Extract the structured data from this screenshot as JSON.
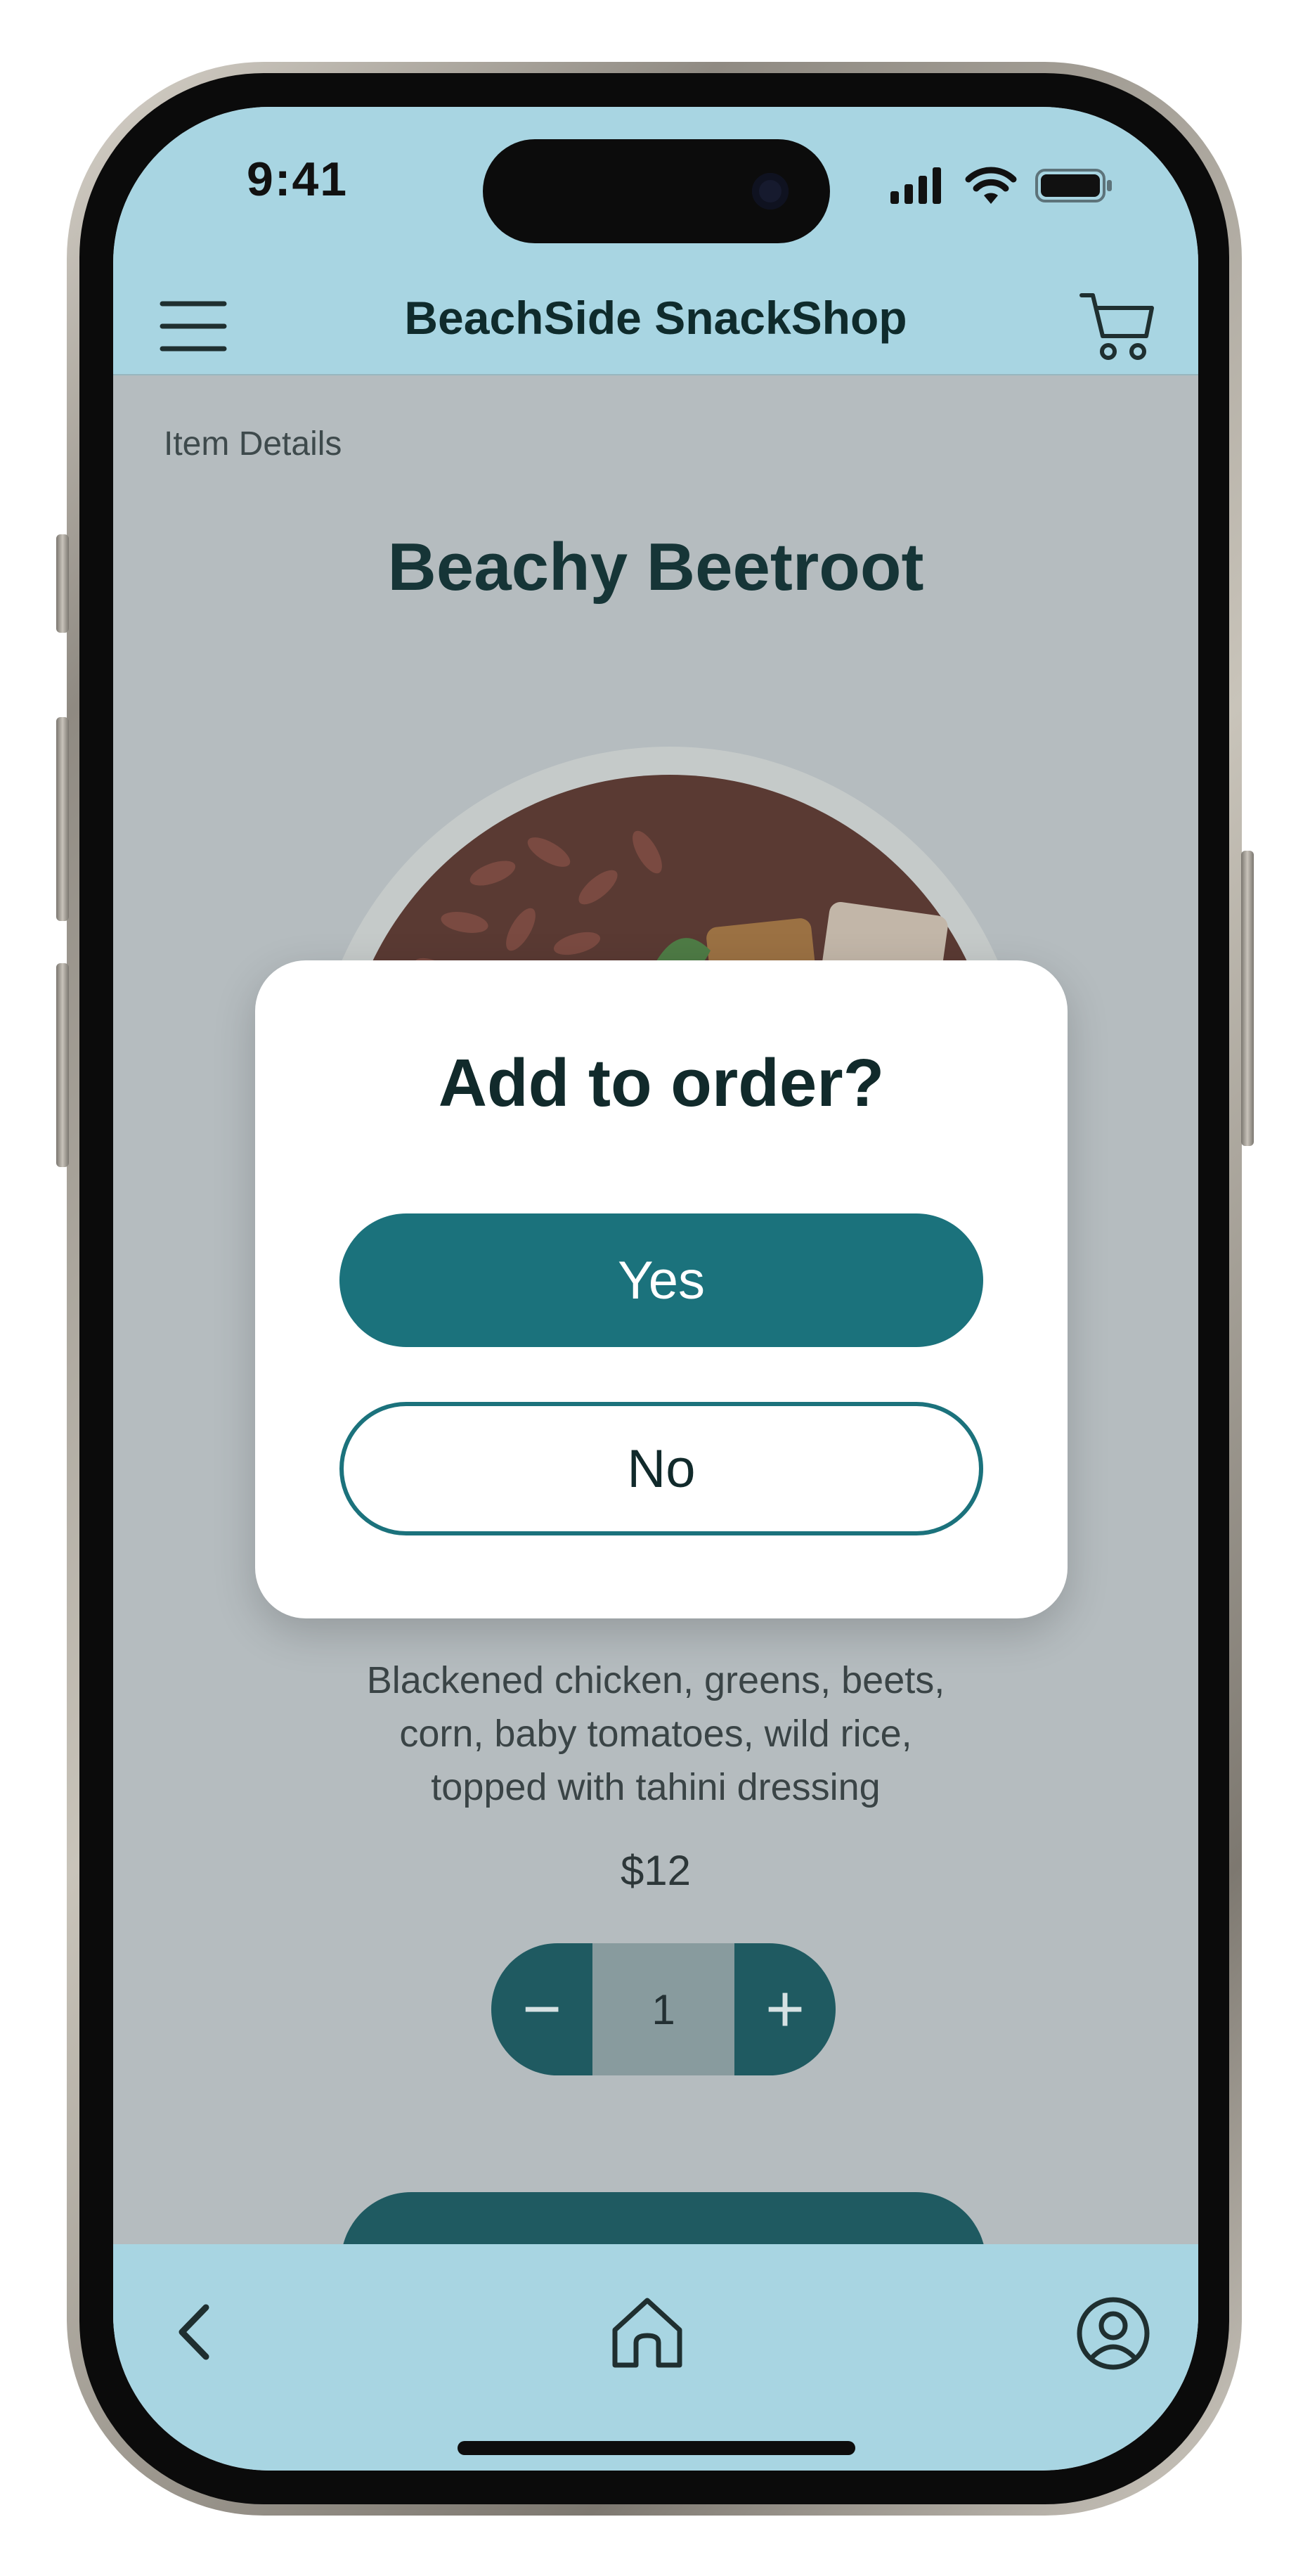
{
  "status_bar": {
    "time": "9:41"
  },
  "header": {
    "app_title": "BeachSide SnackShop"
  },
  "page": {
    "breadcrumb": "Item Details",
    "item_title": "Beachy Beetroot",
    "description": "Blackened chicken, greens, beets, corn, baby tomatoes, wild rice, topped with tahini dressing",
    "price": "$12",
    "quantity": "1",
    "stepper_minus": "−",
    "stepper_plus": "+"
  },
  "dialog": {
    "title": "Add to order?",
    "yes_label": "Yes",
    "no_label": "No"
  },
  "colors": {
    "header_bg": "#a8d5e2",
    "primary": "#1b727c",
    "overlay_bg": "#b5bcbf"
  },
  "icons": {
    "menu": "hamburger-icon",
    "cart": "cart-icon",
    "back": "chevron-left-icon",
    "home": "home-icon",
    "profile": "profile-icon"
  }
}
